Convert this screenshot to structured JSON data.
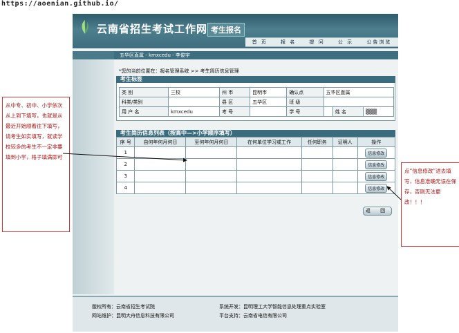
{
  "watermark": "https://aoenian.github.io/",
  "header": {
    "title": "云南省招生考试工作网",
    "subtitle": "考生报名",
    "nav": [
      "首 页",
      "报 名",
      "提 问",
      "公 示",
      "公告浏览"
    ]
  },
  "breadcrumb": "五华区直属 - kmxcedu - 李俊宇",
  "location": "*您的当前位置在：报名管理系统 >> 考生简历信息管理",
  "student": {
    "section_title": "考生标签",
    "rows": [
      [
        {
          "t": "类 别",
          "l": true
        },
        {
          "t": "三校"
        },
        {
          "t": "州 市",
          "l": true
        },
        {
          "t": "昆明市"
        },
        {
          "t": "确认点",
          "l": true
        },
        {
          "t": "五华区直属",
          "span": 3
        }
      ],
      [
        {
          "t": "科类/类别",
          "l": true
        },
        {
          "t": ""
        },
        {
          "t": "县 区",
          "l": true
        },
        {
          "t": "五华区"
        },
        {
          "t": "班 级",
          "l": true
        },
        {
          "t": "",
          "span": 3
        }
      ],
      [
        {
          "t": "用 户 名",
          "l": true
        },
        {
          "t": "kmxcedu"
        },
        {
          "t": "考 号",
          "l": true
        },
        {
          "t": ""
        },
        {
          "t": "学 号",
          "l": true
        },
        {
          "t": ""
        },
        {
          "t": "姓 名",
          "l": true
        },
        {
          "t": "▒▒▒"
        }
      ]
    ]
  },
  "history": {
    "section_title": "考生简历信息列表（按高中—>小学顺序填写）",
    "columns": [
      "序 号",
      "自何年何月何日",
      "至何年何月何日",
      "在何单位学习或工作",
      "任何职务",
      "证明人",
      "操作"
    ],
    "rows": [
      "1",
      "2",
      "3",
      "4"
    ],
    "edit_label": "信息修改",
    "back_label": "返 回"
  },
  "footer": {
    "copyright": "版权所有：云南省招生考试院",
    "maintain": "网站维护：昆明大舟信息科技有限公司",
    "dev": "系统开发：昆明理工大学智能信息处理重点实验室",
    "platform": "平台支持：云南省电信有限公司"
  },
  "annotations": {
    "left": "从中专、初中、小学依次从上到下填写，也就是从最近开始顺着往下填写，请考生如实填写，就读学校较多的考生不一定非要填到小学，格子填满即可",
    "right": "点“信息修改”进去填写，信息准确无误在保存，否则无法更改！！！"
  },
  "colors": {
    "header": "#3e6d7e",
    "accent": "#b01010"
  }
}
